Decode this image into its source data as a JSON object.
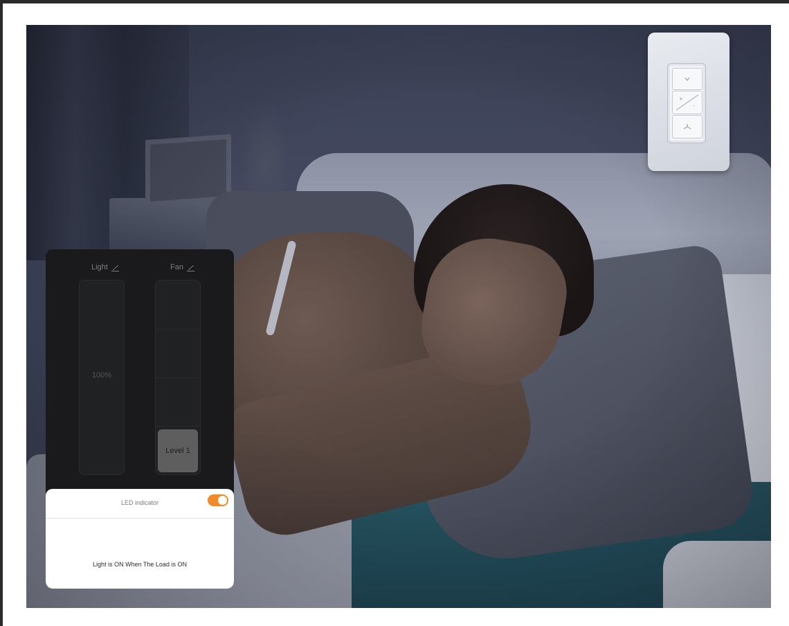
{
  "app_panel": {
    "light": {
      "label": "Light",
      "value": "100%"
    },
    "fan": {
      "label": "Fan",
      "level_label": "Level 1",
      "level": 1,
      "levels": 4
    },
    "led": {
      "label": "LED indicator",
      "enabled": true,
      "description": "Light is ON When The Load is ON"
    }
  },
  "wall_switch": {
    "icons": [
      "light-icon",
      "dimmer-icon",
      "fan-icon"
    ]
  },
  "colors": {
    "toggle_on": "#f08a2a",
    "panel_bg": "#1a1a1c",
    "card_bg": "#ffffff"
  }
}
